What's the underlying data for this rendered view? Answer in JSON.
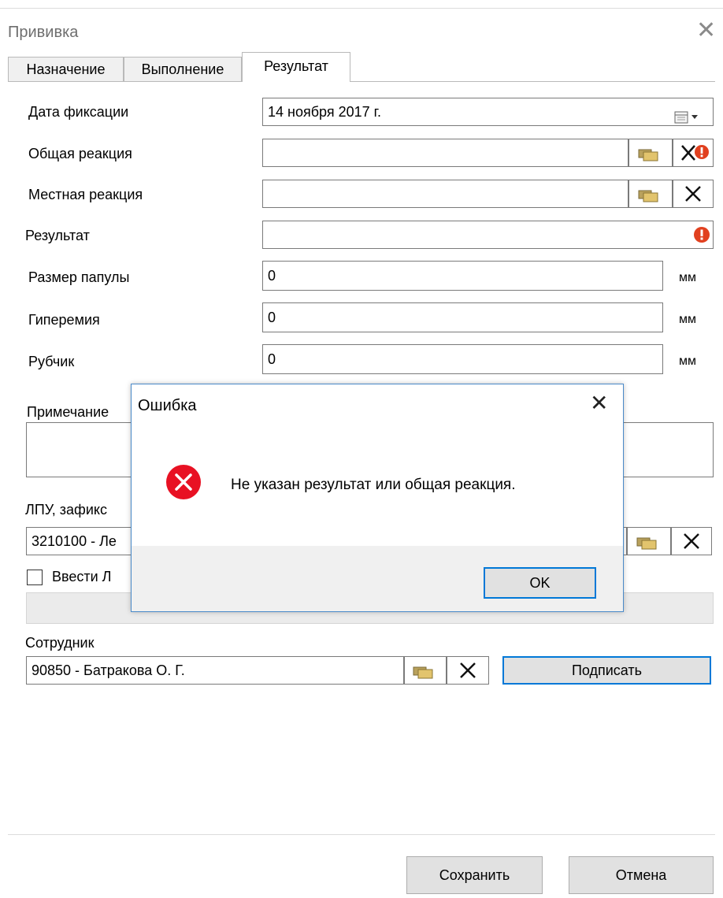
{
  "window": {
    "title": "Прививка"
  },
  "tabs": [
    {
      "label": "Назначение",
      "active": false
    },
    {
      "label": "Выполнение",
      "active": false
    },
    {
      "label": "Результат",
      "active": true
    }
  ],
  "form": {
    "date": {
      "label": "Дата фиксации",
      "value": "14  ноября   2017 г."
    },
    "general_reaction": {
      "label": "Общая реакция",
      "value": ""
    },
    "local_reaction": {
      "label": "Местная реакция",
      "value": ""
    },
    "result": {
      "label": "Результат",
      "value": ""
    },
    "papule_size": {
      "label": "Размер папулы",
      "value": "0",
      "unit": "мм"
    },
    "hyperemia": {
      "label": "Гиперемия",
      "value": "0",
      "unit": "мм"
    },
    "scar": {
      "label": "Рубчик",
      "value": "0",
      "unit": "мм"
    },
    "note": {
      "label": "Примечание"
    },
    "lpu": {
      "label_visible": "ЛПУ, зафикс",
      "value_visible": "3210100 - Ле"
    },
    "enter_lpu": {
      "label_visible": "Ввести Л",
      "checked": false
    },
    "employee": {
      "label": "Сотрудник",
      "value": "90850 - Батракова О. Г."
    },
    "sign_label": "Подписать"
  },
  "footer": {
    "save_label": "Сохранить",
    "cancel_label": "Отмена"
  },
  "dialog": {
    "title": "Ошибка",
    "message": "Не указан результат или общая реакция.",
    "ok_label": "OK"
  },
  "colors": {
    "error_red": "#e81123",
    "dialog_border": "#4a8ac9",
    "focus_blue": "#0078d7"
  }
}
